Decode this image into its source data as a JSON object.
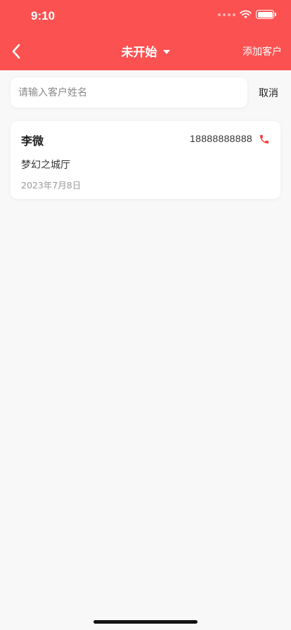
{
  "status_bar": {
    "time": "9:10"
  },
  "nav": {
    "title": "未开始",
    "add_label": "添加客户"
  },
  "search": {
    "placeholder": "请输入客户姓名",
    "value": "",
    "cancel_label": "取消"
  },
  "customers": [
    {
      "name": "李微",
      "phone": "18888888888",
      "venue": "梦幻之城厅",
      "date": "2023年7月8日"
    }
  ],
  "colors": {
    "header_bg": "#fc5151",
    "page_bg": "#f8f8f8",
    "phone_icon": "#f23b3b"
  },
  "icons": {
    "back": "chevron-left-icon",
    "dropdown": "caret-down-icon",
    "call": "phone-icon",
    "wifi": "wifi-icon",
    "battery": "battery-icon"
  }
}
